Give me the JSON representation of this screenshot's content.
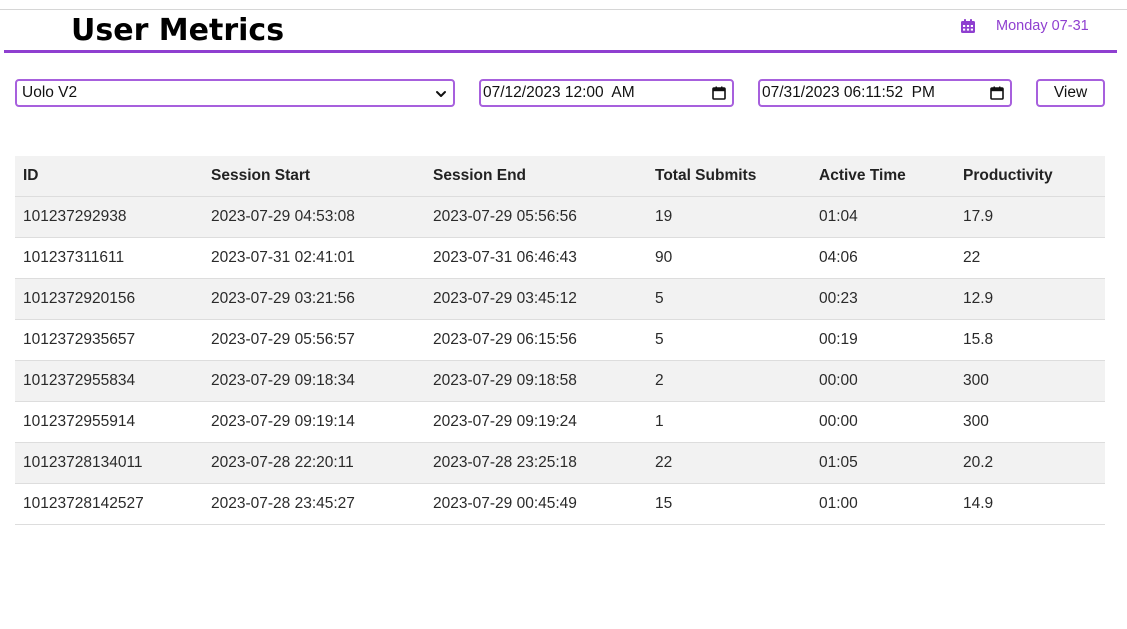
{
  "header": {
    "title": "User Metrics",
    "date": "Monday 07-31",
    "date_icon": "calendar-icon",
    "accent_color": "#8f3fd0"
  },
  "filters": {
    "app_select": {
      "value": "Uolo V2",
      "icon": "chevron-down-icon"
    },
    "start_datetime": {
      "value": "07/12/2023 12:00  AM",
      "icon": "calendar-icon"
    },
    "end_datetime": {
      "value": "07/31/2023 06:11:52  PM",
      "icon": "calendar-icon"
    },
    "view_label": "View"
  },
  "table": {
    "columns": [
      "ID",
      "Session Start",
      "Session End",
      "Total Submits",
      "Active Time",
      "Productivity"
    ],
    "rows": [
      [
        "101237292938",
        "2023-07-29 04:53:08",
        "2023-07-29 05:56:56",
        "19",
        "01:04",
        "17.9"
      ],
      [
        "101237311611",
        "2023-07-31 02:41:01",
        "2023-07-31 06:46:43",
        "90",
        "04:06",
        "22"
      ],
      [
        "1012372920156",
        "2023-07-29 03:21:56",
        "2023-07-29 03:45:12",
        "5",
        "00:23",
        "12.9"
      ],
      [
        "1012372935657",
        "2023-07-29 05:56:57",
        "2023-07-29 06:15:56",
        "5",
        "00:19",
        "15.8"
      ],
      [
        "1012372955834",
        "2023-07-29 09:18:34",
        "2023-07-29 09:18:58",
        "2",
        "00:00",
        "300"
      ],
      [
        "1012372955914",
        "2023-07-29 09:19:14",
        "2023-07-29 09:19:24",
        "1",
        "00:00",
        "300"
      ],
      [
        "10123728134011",
        "2023-07-28 22:20:11",
        "2023-07-28 23:25:18",
        "22",
        "01:05",
        "20.2"
      ],
      [
        "10123728142527",
        "2023-07-28 23:45:27",
        "2023-07-29 00:45:49",
        "15",
        "01:00",
        "14.9"
      ]
    ]
  }
}
